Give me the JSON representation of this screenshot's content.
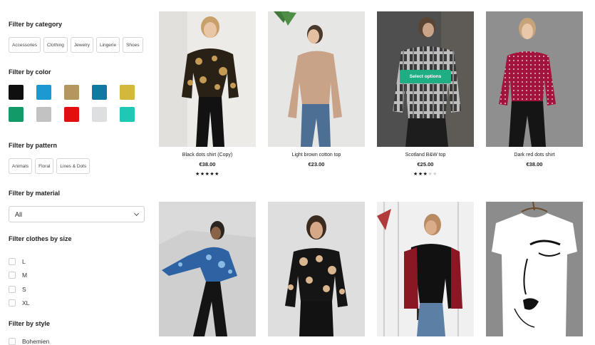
{
  "filters": {
    "category": {
      "title": "Filter by category",
      "items": [
        "Accessories",
        "Clothing",
        "Jewelry",
        "Lingerie",
        "Shoes"
      ]
    },
    "color": {
      "title": "Filter by color",
      "swatches": [
        "#0f0f0f",
        "#1a9ad0",
        "#b4965f",
        "#0f7aa0",
        "#d4b83c",
        "#129b68",
        "#c2c2c2",
        "#e30f0f",
        "#dedfe0",
        "#1ec8b4"
      ]
    },
    "pattern": {
      "title": "Filter by pattern",
      "items": [
        "Animals",
        "Floral",
        "Lines & Dots"
      ]
    },
    "material": {
      "title": "Filter by material",
      "selected": "All"
    },
    "size": {
      "title": "Filter clothes by size",
      "items": [
        "L",
        "M",
        "S",
        "XL"
      ]
    },
    "style": {
      "title": "Filter by style",
      "items": [
        "Bohemien"
      ]
    }
  },
  "products": [
    {
      "name": "Black dots shirt (Copy)",
      "price": "€38.00",
      "rating": 5,
      "max_rating": 5
    },
    {
      "name": "Light brown cotton top",
      "price": "€23.00"
    },
    {
      "name": "Scotland B&W top",
      "price": "€25.00",
      "rating": 3,
      "max_rating": 5,
      "button": "Select options"
    },
    {
      "name": "Dark red dots shirt",
      "price": "€38.00"
    },
    {
      "name": ""
    },
    {
      "name": ""
    },
    {
      "name": ""
    },
    {
      "name": ""
    }
  ],
  "colors": {
    "accent": "#1fad84"
  }
}
